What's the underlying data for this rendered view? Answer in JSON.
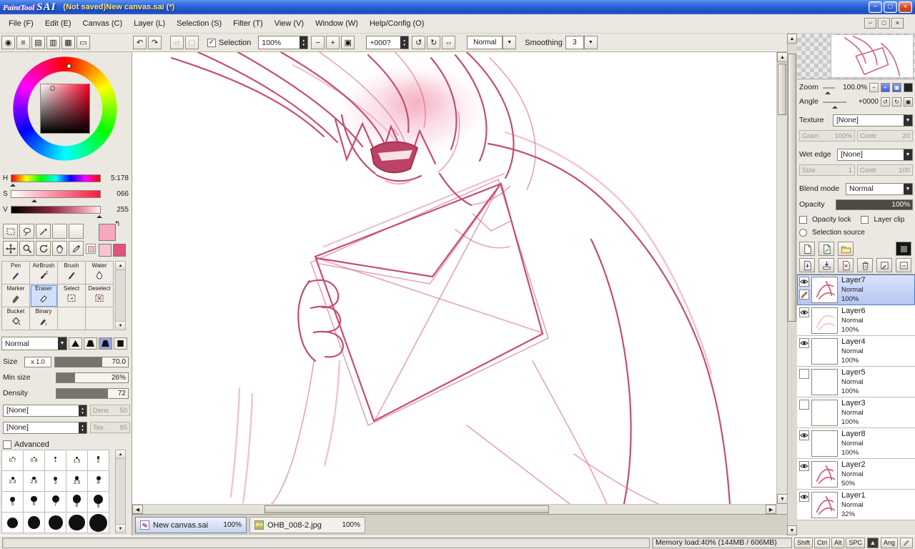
{
  "titlebar": {
    "logo_paint": "PaintTool",
    "logo_sai": "SAI",
    "title": "(Not saved)New canvas.sai (*)"
  },
  "icons": {
    "minimize": "−",
    "maximize": "□",
    "close": "×",
    "check": "✓",
    "tri_up": "▲",
    "tri_down": "▼",
    "tri_left": "◀",
    "tri_right": "▶",
    "undo": "↶",
    "redo": "↷",
    "sel_move": "▱",
    "sel_copy": "▢",
    "minus": "−",
    "plus": "+",
    "fit": "▣",
    "rot_ccw": "↺",
    "rot_cw": "↻",
    "flip": "⇔",
    "dd": "▼",
    "swap_arrow": "↰",
    "jpg_badge": "JPG"
  },
  "menu": {
    "items": [
      {
        "label": "File (F)"
      },
      {
        "label": "Edit (E)"
      },
      {
        "label": "Canvas (C)"
      },
      {
        "label": "Layer (L)"
      },
      {
        "label": "Selection (S)"
      },
      {
        "label": "Filter (T)"
      },
      {
        "label": "View (V)"
      },
      {
        "label": "Window (W)"
      },
      {
        "label": "Help/Config (O)"
      }
    ]
  },
  "toolbar": {
    "left_icons": [
      {
        "name": "color-wheel",
        "glyph": "◉"
      },
      {
        "name": "rgb-sliders",
        "glyph": "≡"
      },
      {
        "name": "swatch-grid",
        "glyph": "▤"
      },
      {
        "name": "swatch-list",
        "glyph": "▥"
      },
      {
        "name": "custom-palette",
        "glyph": "▦"
      },
      {
        "name": "screen-view",
        "glyph": "▭"
      }
    ],
    "selection_label": "Selection",
    "zoom_value": "100%",
    "rotate_value": "+000?",
    "mode_value": "Normal",
    "smoothing_label": "Smoothing",
    "smoothing_value": "3"
  },
  "color_panel": {
    "h_label": "H",
    "h_value": "5:178",
    "s_label": "S",
    "s_value": "066",
    "v_label": "V",
    "v_value": "255"
  },
  "quick_tools": {
    "row1": [
      "rect-select",
      "lasso",
      "magic-wand",
      "blank",
      "blank"
    ],
    "row2": [
      "move",
      "zoom",
      "rotate",
      "hand",
      "eyedropper"
    ]
  },
  "tool_grid": {
    "selected": "Eraser",
    "items": [
      {
        "label": "Pen",
        "icon": "pen"
      },
      {
        "label": "AirBrush",
        "icon": "airbrush"
      },
      {
        "label": "Brush",
        "icon": "brush"
      },
      {
        "label": "Water",
        "icon": "water"
      },
      {
        "label": "Marker",
        "icon": "marker"
      },
      {
        "label": "Eraser",
        "icon": "eraser"
      },
      {
        "label": "Select",
        "icon": "select"
      },
      {
        "label": "Deselect",
        "icon": "deselect"
      },
      {
        "label": "Bucket",
        "icon": "bucket"
      },
      {
        "label": "Binary",
        "icon": "binary"
      }
    ]
  },
  "brush": {
    "mode_value": "Normal",
    "tip_names": [
      "tip-triangle",
      "tip-trapezoid",
      "tip-trapezoid-soft",
      "tip-flat"
    ],
    "tip_selected": 2,
    "size_label": "Size",
    "size_unit": "x 1.0",
    "size_value": "70.0",
    "minsize_label": "Min size",
    "minsize_value": "26%",
    "density_label": "Density",
    "density_value": "72",
    "combo1_value": "[None]",
    "combo1_param": "Dens",
    "combo1_num": "50",
    "combo2_value": "[None]",
    "combo2_param": "Tex.",
    "combo2_num": "95",
    "advanced_label": "Advanced"
  },
  "size_palette": {
    "labels": [
      "0.7",
      "0.8",
      "1",
      "1.5",
      "2",
      "2.3",
      "2.6",
      "3",
      "3.5",
      "4",
      "5",
      "6",
      "7",
      "8",
      "9",
      "",
      "",
      "",
      "",
      ""
    ]
  },
  "navigator": {
    "zoom_label": "Zoom",
    "zoom_value": "100.0%",
    "angle_label": "Angle",
    "angle_value": "+0000"
  },
  "layer_panel": {
    "texture_label": "Texture",
    "texture_value": "[None]",
    "grain_label": "Grain",
    "grain_value": "100%",
    "contr_label": "Contr",
    "contr_value": "20",
    "wetedge_label": "Wet edge",
    "wetedge_value": "[None]",
    "wsize_label": "Size",
    "wsize_value": "1",
    "wcontr_label": "Contr",
    "wcontr_value": "100",
    "blend_label": "Blend mode",
    "blend_value": "Normal",
    "opacity_label": "Opacity",
    "opacity_value": "100%",
    "opacity_lock_label": "Opacity lock",
    "layer_clip_label": "Layer clip",
    "selection_source_label": "Selection source",
    "buttons_row1": [
      "new-layer",
      "new-lineart-layer",
      "new-layer-set",
      "mask"
    ],
    "buttons_row2": [
      "transfer-down",
      "merge-down",
      "clear-layer",
      "delete-layer",
      "paper-pen-a",
      "paper-pen-b"
    ]
  },
  "layers": [
    {
      "name": "Layer7",
      "mode": "Normal",
      "opacity": "100%",
      "visible": true,
      "selected": true,
      "thumb": "sketch"
    },
    {
      "name": "Layer6",
      "mode": "Normal",
      "opacity": "100%",
      "visible": true,
      "selected": false,
      "thumb": "light"
    },
    {
      "name": "Layer4",
      "mode": "Normal",
      "opacity": "100%",
      "visible": true,
      "selected": false,
      "thumb": "blank"
    },
    {
      "name": "Layer5",
      "mode": "Normal",
      "opacity": "100%",
      "visible": false,
      "selected": false,
      "thumb": "blank"
    },
    {
      "name": "Layer3",
      "mode": "Normal",
      "opacity": "100%",
      "visible": false,
      "selected": false,
      "thumb": "blank"
    },
    {
      "name": "Layer8",
      "mode": "Normal",
      "opacity": "100%",
      "visible": true,
      "selected": false,
      "thumb": "blank"
    },
    {
      "name": "Layer2",
      "mode": "Normal",
      "opacity": "50%",
      "visible": true,
      "selected": false,
      "thumb": "sketch"
    },
    {
      "name": "Layer1",
      "mode": "Normal",
      "opacity": "32%",
      "visible": true,
      "selected": false,
      "thumb": "sketch"
    }
  ],
  "tabs": [
    {
      "name": "New canvas.sai",
      "zoom": "100%",
      "icon": "sai",
      "active": true
    },
    {
      "name": "OHB_008-2.jpg",
      "zoom": "100%",
      "icon": "jpg",
      "active": false
    }
  ],
  "statusbar": {
    "memory": "Memory load:40% (144MB / 606MB)",
    "keys": [
      "Shift",
      "Ctrl",
      "Alt",
      "SPC"
    ],
    "extra": "Ang"
  },
  "colors": {
    "sketch_stroke": "#c74d72",
    "sketch_light": "#efb9ca",
    "selected_layer": "#b4c6f4",
    "titlebar_blue": "#2a5fd8",
    "chrome": "#ebe8e1"
  }
}
